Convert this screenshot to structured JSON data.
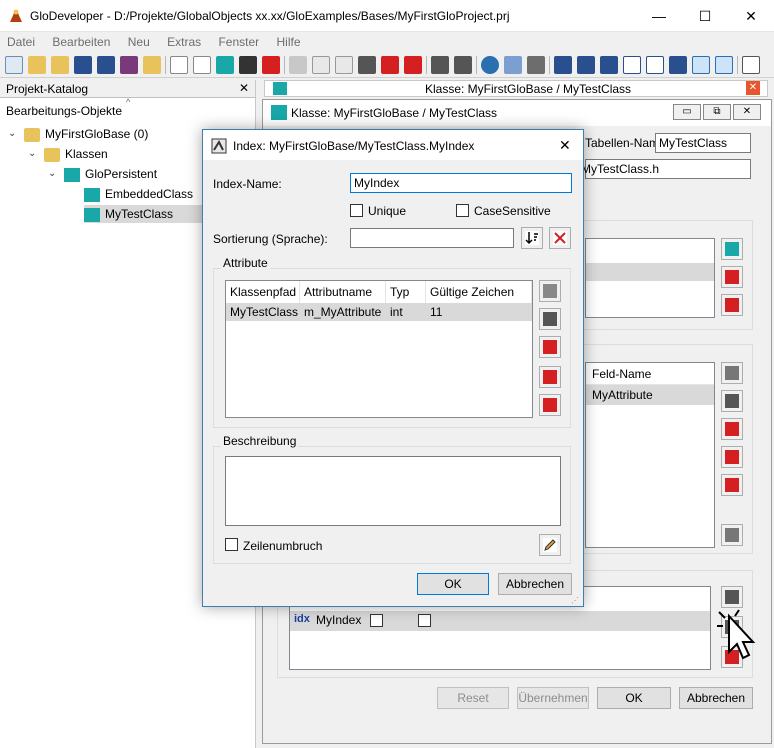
{
  "window": {
    "title": "GloDeveloper - D:/Projekte/GlobalObjects xx.xx/GloExamples/Bases/MyFirstGloProject.prj",
    "minimize": "—",
    "maximize": "☐",
    "close": "✕"
  },
  "menu": [
    "Datei",
    "Bearbeiten",
    "Neu",
    "Extras",
    "Fenster",
    "Hilfe"
  ],
  "left_panel": {
    "title": "Projekt-Katalog",
    "close": "✕",
    "tree_header": "Bearbeitungs-Objekte",
    "tree": {
      "root": "MyFirstGloBase (0)",
      "classes": "Klassen",
      "persistent": "GloPersistent",
      "embedded": "EmbeddedClass",
      "mytest": "MyTestClass"
    }
  },
  "mdi": {
    "tab_title": "Klasse: MyFirstGloBase / MyTestClass",
    "inner_title": "Klasse: MyFirstGloBase / MyTestClass",
    "tabellen_label": "Tabellen-Name:",
    "tabellen_value": "MyTestClass",
    "header_file_value": "MyTestClass.h",
    "feld_name_header": "Feld-Name",
    "feld_name_value": "MyAttribute",
    "index_row_name": "MyIndex",
    "index_row_icon": "idx",
    "buttons": {
      "reset": "Reset",
      "apply": "Übernehmen",
      "ok": "OK",
      "cancel": "Abbrechen"
    }
  },
  "dialog": {
    "title": "Index: MyFirstGloBase/MyTestClass.MyIndex",
    "close": "✕",
    "index_name_label": "Index-Name:",
    "index_name_value": "MyIndex",
    "unique_label": "Unique",
    "casesensitive_label": "CaseSensitive",
    "sort_label": "Sortierung (Sprache):",
    "sort_value": "",
    "attribute_group": "Attribute",
    "columns": [
      "Klassenpfad",
      "Attributname",
      "Typ",
      "Gültige Zeichen"
    ],
    "rows": [
      {
        "klassenpfad": "MyTestClass",
        "attributname": "m_MyAttribute",
        "typ": "int",
        "zeichen": "11"
      }
    ],
    "beschreibung_group": "Beschreibung",
    "beschreibung_value": "",
    "zeilenumbruch_label": "Zeilenumbruch",
    "ok": "OK",
    "cancel": "Abbrechen"
  },
  "colors": {
    "selection": "#d9d9d9",
    "accent": "#0078d7",
    "icon_teal": "#1aa7a7",
    "icon_red": "#d42020",
    "folder": "#e8c25a"
  }
}
